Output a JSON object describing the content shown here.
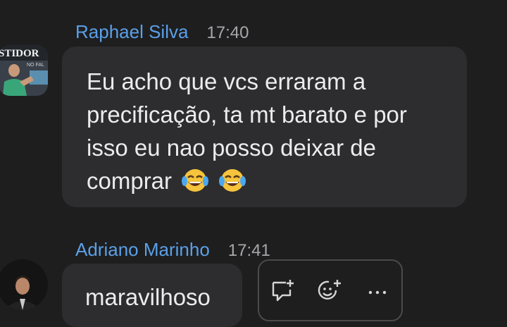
{
  "messages": [
    {
      "sender": "Raphael Silva",
      "time": "17:40",
      "text": "Eu acho que vcs erraram a precificação, ta mt barato e por isso eu nao posso deixar de comprar",
      "avatar_text": "STIDOR",
      "avatar_subtext": "NO FAL",
      "emoji": [
        "joy-emoji",
        "joy-emoji"
      ]
    },
    {
      "sender": "Adriano Marinho",
      "time": "17:41",
      "text": "maravilhoso"
    }
  ],
  "message_actions": {
    "icons": [
      "reply-icon",
      "add-reaction-icon",
      "more-icon"
    ],
    "more_label": "···"
  },
  "colors": {
    "background": "#1e1e1f",
    "bubble": "#2d2d2f",
    "name": "#5aa0e8",
    "time": "#a7a7ab",
    "text": "#ececec"
  }
}
